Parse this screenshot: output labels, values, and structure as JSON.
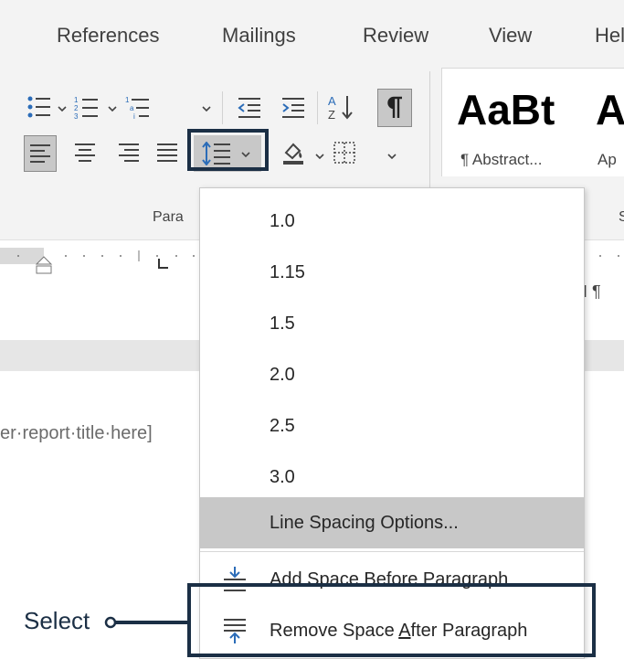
{
  "ribbon": {
    "tabs": [
      "References",
      "Mailings",
      "Review",
      "View",
      "Hel"
    ],
    "paragraph_group_label": "Para",
    "styles_group_label_partial": "S"
  },
  "styles": {
    "sample1": "AaBt",
    "name1": "¶ Abstract...",
    "sample2": "A",
    "name2": "Ap"
  },
  "document": {
    "visible_text": "er·report·title·here]"
  },
  "line_spacing_menu": {
    "items": [
      "1.0",
      "1.15",
      "1.5",
      "2.0",
      "2.5",
      "3.0"
    ],
    "options_label": "Line Spacing Options...",
    "add_space_label": "Add Space Before Paragraph",
    "remove_space_label_before": "Remove Space ",
    "remove_space_label_accel": "A",
    "remove_space_label_after": "fter Paragraph"
  },
  "callout": {
    "label": "Select"
  },
  "colors": {
    "highlight_border": "#1b2f45",
    "ribbon_bg": "#f3f3f3",
    "selected_item_bg": "#c8c8c8",
    "icon_blue": "#2b6cb8"
  }
}
